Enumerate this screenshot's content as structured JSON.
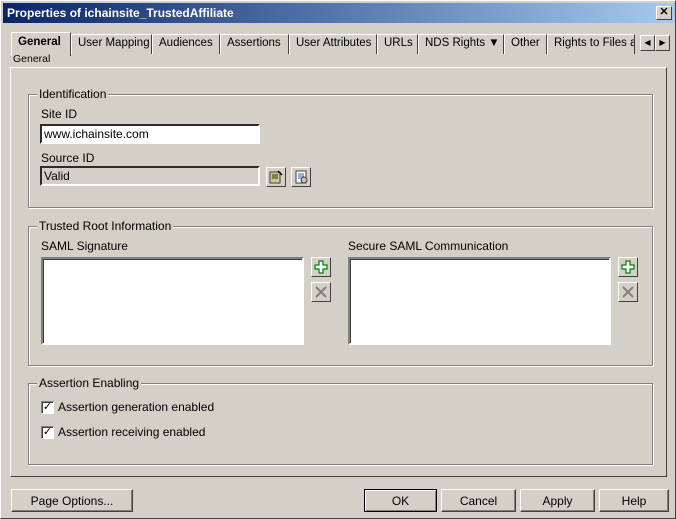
{
  "window": {
    "title": "Properties of ichainsite_TrustedAffiliate"
  },
  "tabs": [
    {
      "label": "General"
    },
    {
      "label": "User Mapping"
    },
    {
      "label": "Audiences"
    },
    {
      "label": "Assertions"
    },
    {
      "label": "User Attributes"
    },
    {
      "label": "URLs"
    },
    {
      "label": "NDS Rights ▼"
    },
    {
      "label": "Other"
    },
    {
      "label": "Rights to Files a"
    }
  ],
  "subtab": {
    "label": "General"
  },
  "identification": {
    "title": "Identification",
    "site_id_label": "Site ID",
    "site_id_value": "www.ichainsite.com",
    "source_id_label": "Source ID",
    "source_id_value": "Valid"
  },
  "trusted_root": {
    "title": "Trusted Root Information",
    "saml_signature_label": "SAML Signature",
    "secure_saml_label": "Secure SAML Communication"
  },
  "assertion": {
    "title": "Assertion Enabling",
    "generation_label": "Assertion generation enabled",
    "receiving_label": "Assertion receiving enabled",
    "generation_checked": true,
    "receiving_checked": true
  },
  "buttons": {
    "page_options": "Page Options...",
    "ok": "OK",
    "cancel": "Cancel",
    "apply": "Apply",
    "help": "Help"
  },
  "glyphs": {
    "close": "✕",
    "check": "✓",
    "left": "◀",
    "right": "▶"
  }
}
